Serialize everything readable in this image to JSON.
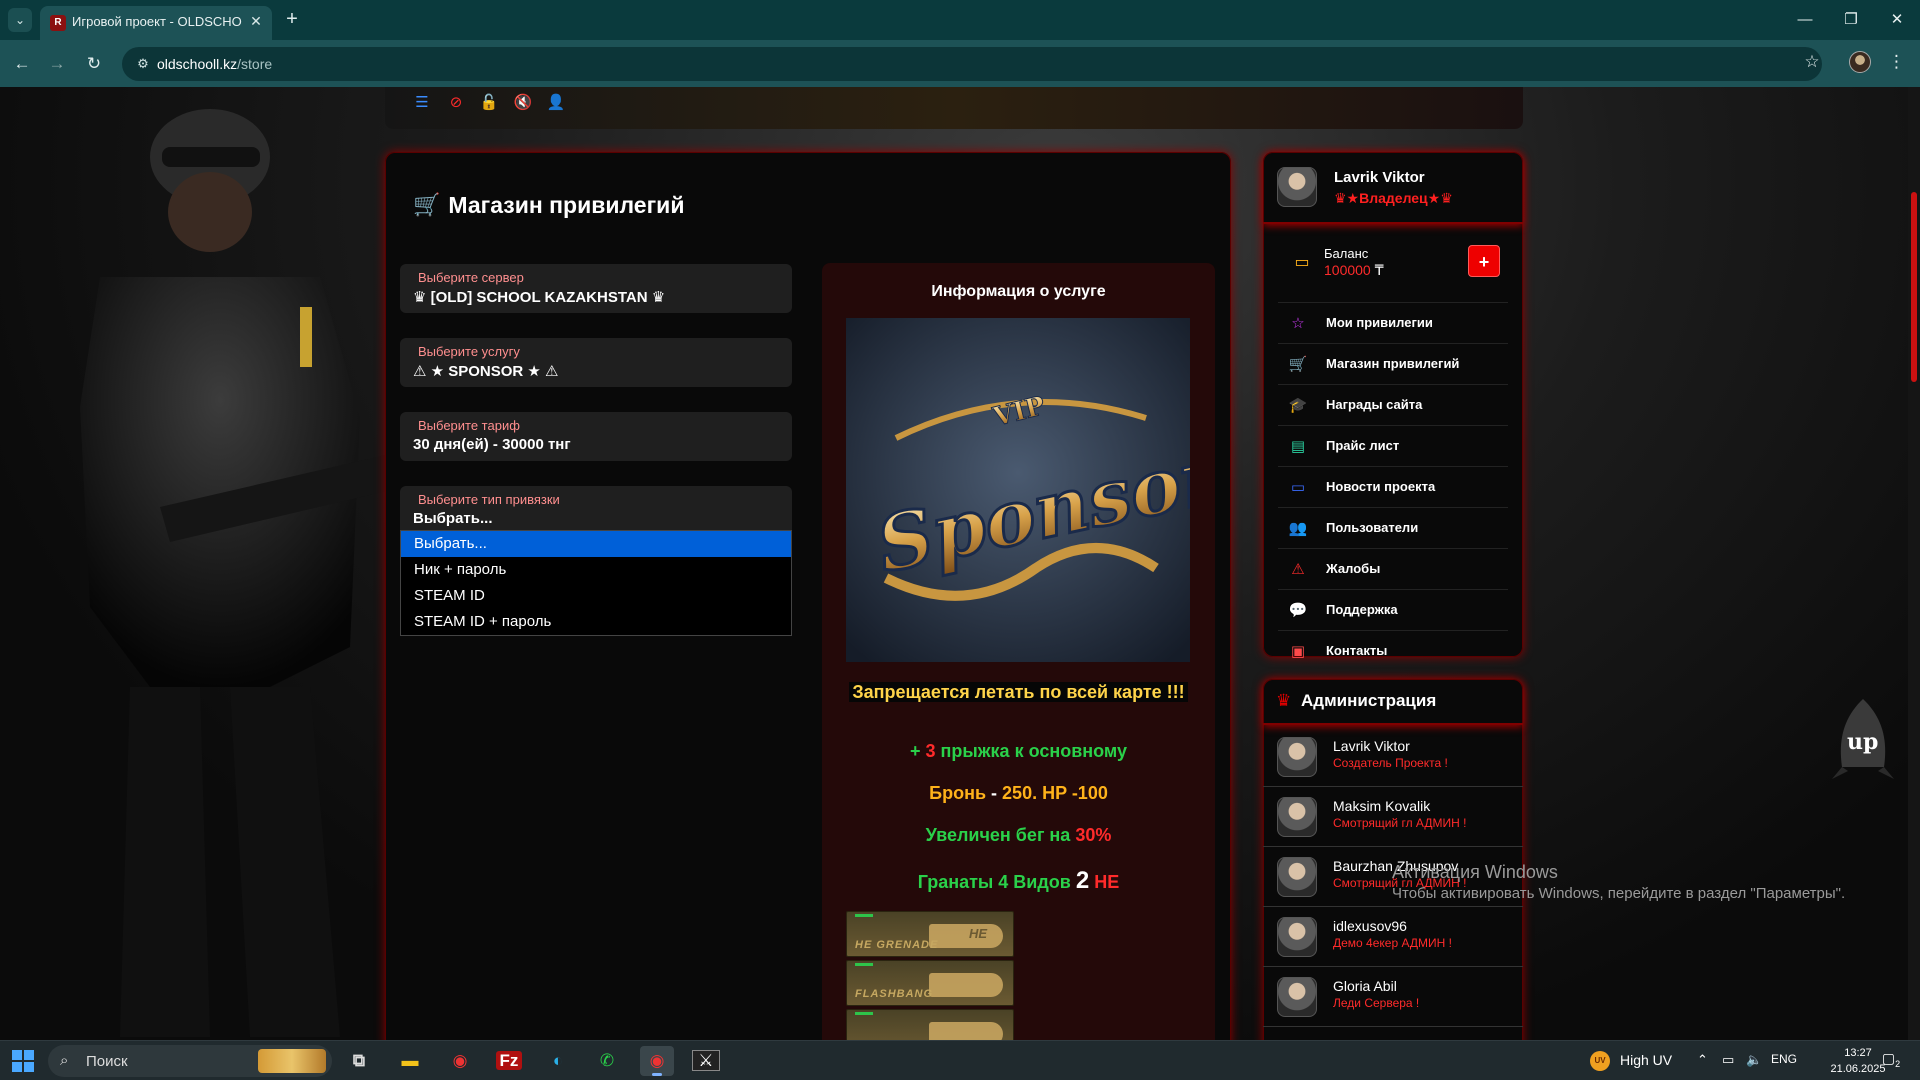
{
  "browser": {
    "tab_title": "Игровой проект - OLDSCHOOL",
    "tab_favicon": "R",
    "url_host": "oldschooll.kz",
    "url_path": "/store"
  },
  "store": {
    "title": "Магазин привилегий",
    "fields": [
      {
        "label": "Выберите сервер",
        "value": "♛ [OLD] SCHOOL KAZAKHSTAN ♛"
      },
      {
        "label": "Выберите услугу",
        "value": "⚠ ★ SPONSOR ★ ⚠"
      },
      {
        "label": "Выберите тариф",
        "value": "30 дня(ей) - 30000 тнг"
      },
      {
        "label": "Выберите тип привязки",
        "value": "Выбрать..."
      }
    ],
    "binding_options": [
      "Выбрать...",
      "Ник + пароль",
      "STEAM ID",
      "STEAM ID + пароль"
    ],
    "binding_selected_index": 0
  },
  "info": {
    "title": "Информация о услуге",
    "image_logo_text": "Sponsor",
    "image_badge": "VIP",
    "forbidden": "Запрещается летать по всей карте !!!",
    "perks": {
      "jumps_plus": "+",
      "jumps_count": "3",
      "jumps_text": "прыжка к основному",
      "armor_label": "Бронь",
      "armor_dash": "-",
      "armor_value": "250.",
      "hp_label": "HP",
      "hp_value": "-100",
      "run_text": "Увеличен бег на",
      "run_value": "30%",
      "grenades_text": "Гранаты 4 Видов",
      "grenades_number": "2",
      "grenades_type": "HE"
    },
    "grenades": [
      {
        "label": "HE GRENADE",
        "badge": "HE"
      },
      {
        "label": "FLASHBANG",
        "badge": ""
      },
      {
        "label": "",
        "badge": ""
      }
    ]
  },
  "profile": {
    "name": "Lavrik Viktor",
    "role": "♛★Владелец★♛",
    "balance_label": "Баланс",
    "balance_value": "100000",
    "currency": "₸",
    "topup_label": "+",
    "menu": [
      {
        "label": "Мои привилегии",
        "icon": "star-icon",
        "glyph": "☆",
        "color": "#d43cff"
      },
      {
        "label": "Магазин привилегий",
        "icon": "cart-icon",
        "glyph": "🛒",
        "color": "#2ad14a"
      },
      {
        "label": "Награды сайта",
        "icon": "graduation-cap-icon",
        "glyph": "🎓",
        "color": "#f2c21a"
      },
      {
        "label": "Прайс лист",
        "icon": "list-icon",
        "glyph": "▤",
        "color": "#2ad1a0"
      },
      {
        "label": "Новости проекта",
        "icon": "news-icon",
        "glyph": "▭",
        "color": "#3a6cff"
      },
      {
        "label": "Пользователи",
        "icon": "users-icon",
        "glyph": "👥",
        "color": "#3a8cff"
      },
      {
        "label": "Жалобы",
        "icon": "warning-icon",
        "glyph": "⚠",
        "color": "#ff2b2b"
      },
      {
        "label": "Поддержка",
        "icon": "chat-icon",
        "glyph": "💬",
        "color": "#2ad14a"
      },
      {
        "label": "Контакты",
        "icon": "contact-card-icon",
        "glyph": "▣",
        "color": "#ff4a4a"
      }
    ]
  },
  "admin": {
    "title": "Администрация",
    "members": [
      {
        "name": "Lavrik Viktor",
        "role": "Создатель Проекта !"
      },
      {
        "name": "Maksim Kovalik",
        "role": "Смотрящий гл АДМИН !"
      },
      {
        "name": "Baurzhan Zhusupov",
        "role": "Смотрящий гл АДМИН !"
      },
      {
        "name": "idlexusov96",
        "role": "Демо 4екер АДМИН !"
      },
      {
        "name": "Gloria Abil",
        "role": "Леди Сервера !"
      }
    ]
  },
  "scroll_up_label": "up",
  "activation": {
    "title": "Активация Windows",
    "text": "Чтобы активировать Windows, перейдите в раздел \"Параметры\"."
  },
  "taskbar": {
    "search_placeholder": "Поиск",
    "uv_label": "High UV",
    "uv_badge": "UV",
    "lang": "ENG",
    "time": "13:27",
    "date": "21.06.2025",
    "notifications": "2"
  }
}
